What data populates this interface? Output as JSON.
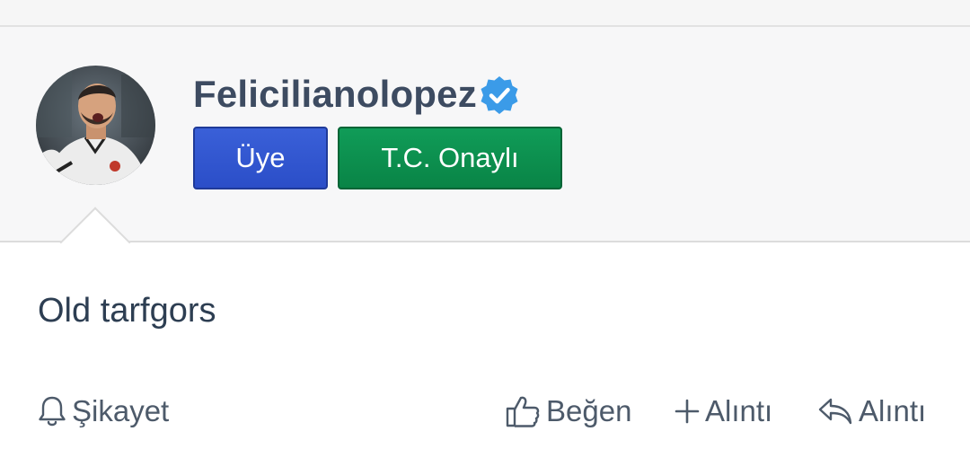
{
  "profile": {
    "username": "Felicilianolopez",
    "verified_icon": "verified-badge-icon",
    "badges": [
      {
        "label": "Üye",
        "color": "#2f55cf"
      },
      {
        "label": "T.C. Onaylı",
        "color": "#0b8f4d"
      }
    ]
  },
  "post": {
    "text": "Old tarfgors"
  },
  "actions": {
    "report": {
      "label": "Şikayet",
      "icon": "bell-icon"
    },
    "like": {
      "label": "Beğen",
      "icon": "thumbs-up-icon"
    },
    "quote": {
      "label": "Alıntı",
      "icon": "plus-icon"
    },
    "reply": {
      "label": "Alıntı",
      "icon": "reply-icon"
    }
  },
  "colors": {
    "username": "#3d4b61",
    "text": "#2d3e52",
    "verified": "#3b9be8"
  }
}
